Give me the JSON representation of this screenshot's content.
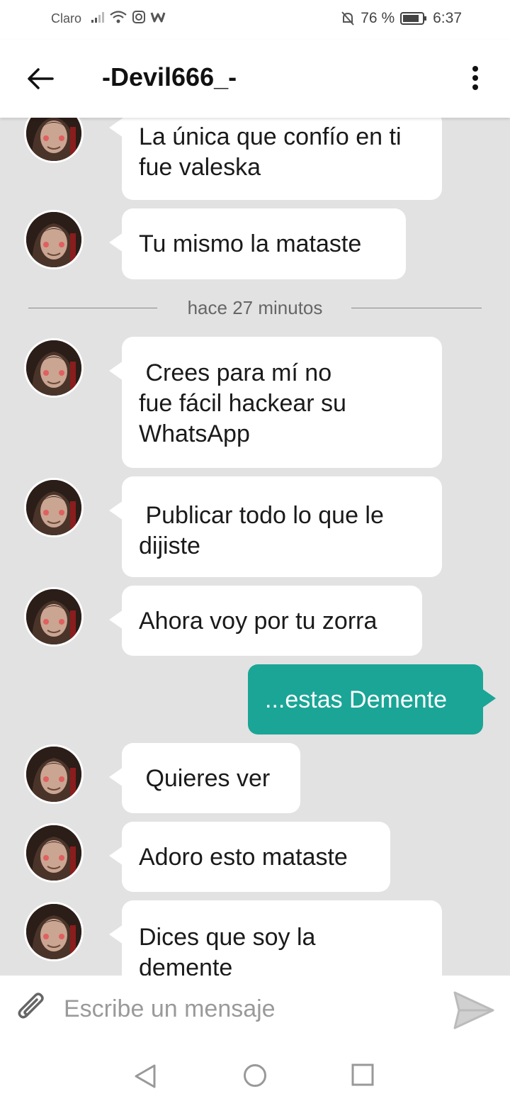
{
  "status_bar": {
    "carrier": "Claro",
    "battery": "76 %",
    "time": "6:37"
  },
  "header": {
    "title": "-Devil666_-"
  },
  "messages": {
    "m1": {
      "lines": [
        "La única que confío en ti",
        "fue  valeska"
      ]
    },
    "m2": {
      "lines": [
        "Tu mismo la mataste"
      ]
    },
    "divider": "hace 27 minutos",
    "m3": {
      "lines": [
        " Crees para mí no",
        "fue fácil hackear su",
        "WhatsApp"
      ]
    },
    "m4": {
      "lines": [
        " Publicar todo lo que le",
        "dijiste"
      ]
    },
    "m5": {
      "lines": [
        "Ahora voy por tu zorra"
      ]
    },
    "m6": {
      "lines": [
        "...estas Demente"
      ]
    },
    "m7": {
      "lines": [
        " Quieres ver"
      ]
    },
    "m8": {
      "lines": [
        "Adoro esto mataste"
      ]
    },
    "m9": {
      "lines": [
        "Dices que soy la",
        "demente"
      ]
    }
  },
  "composer": {
    "placeholder": "Escribe un mensaje"
  },
  "colors": {
    "outgoing_bubble": "#1aa596",
    "chat_background": "#e2e2e2",
    "incoming_bubble": "#ffffff"
  }
}
